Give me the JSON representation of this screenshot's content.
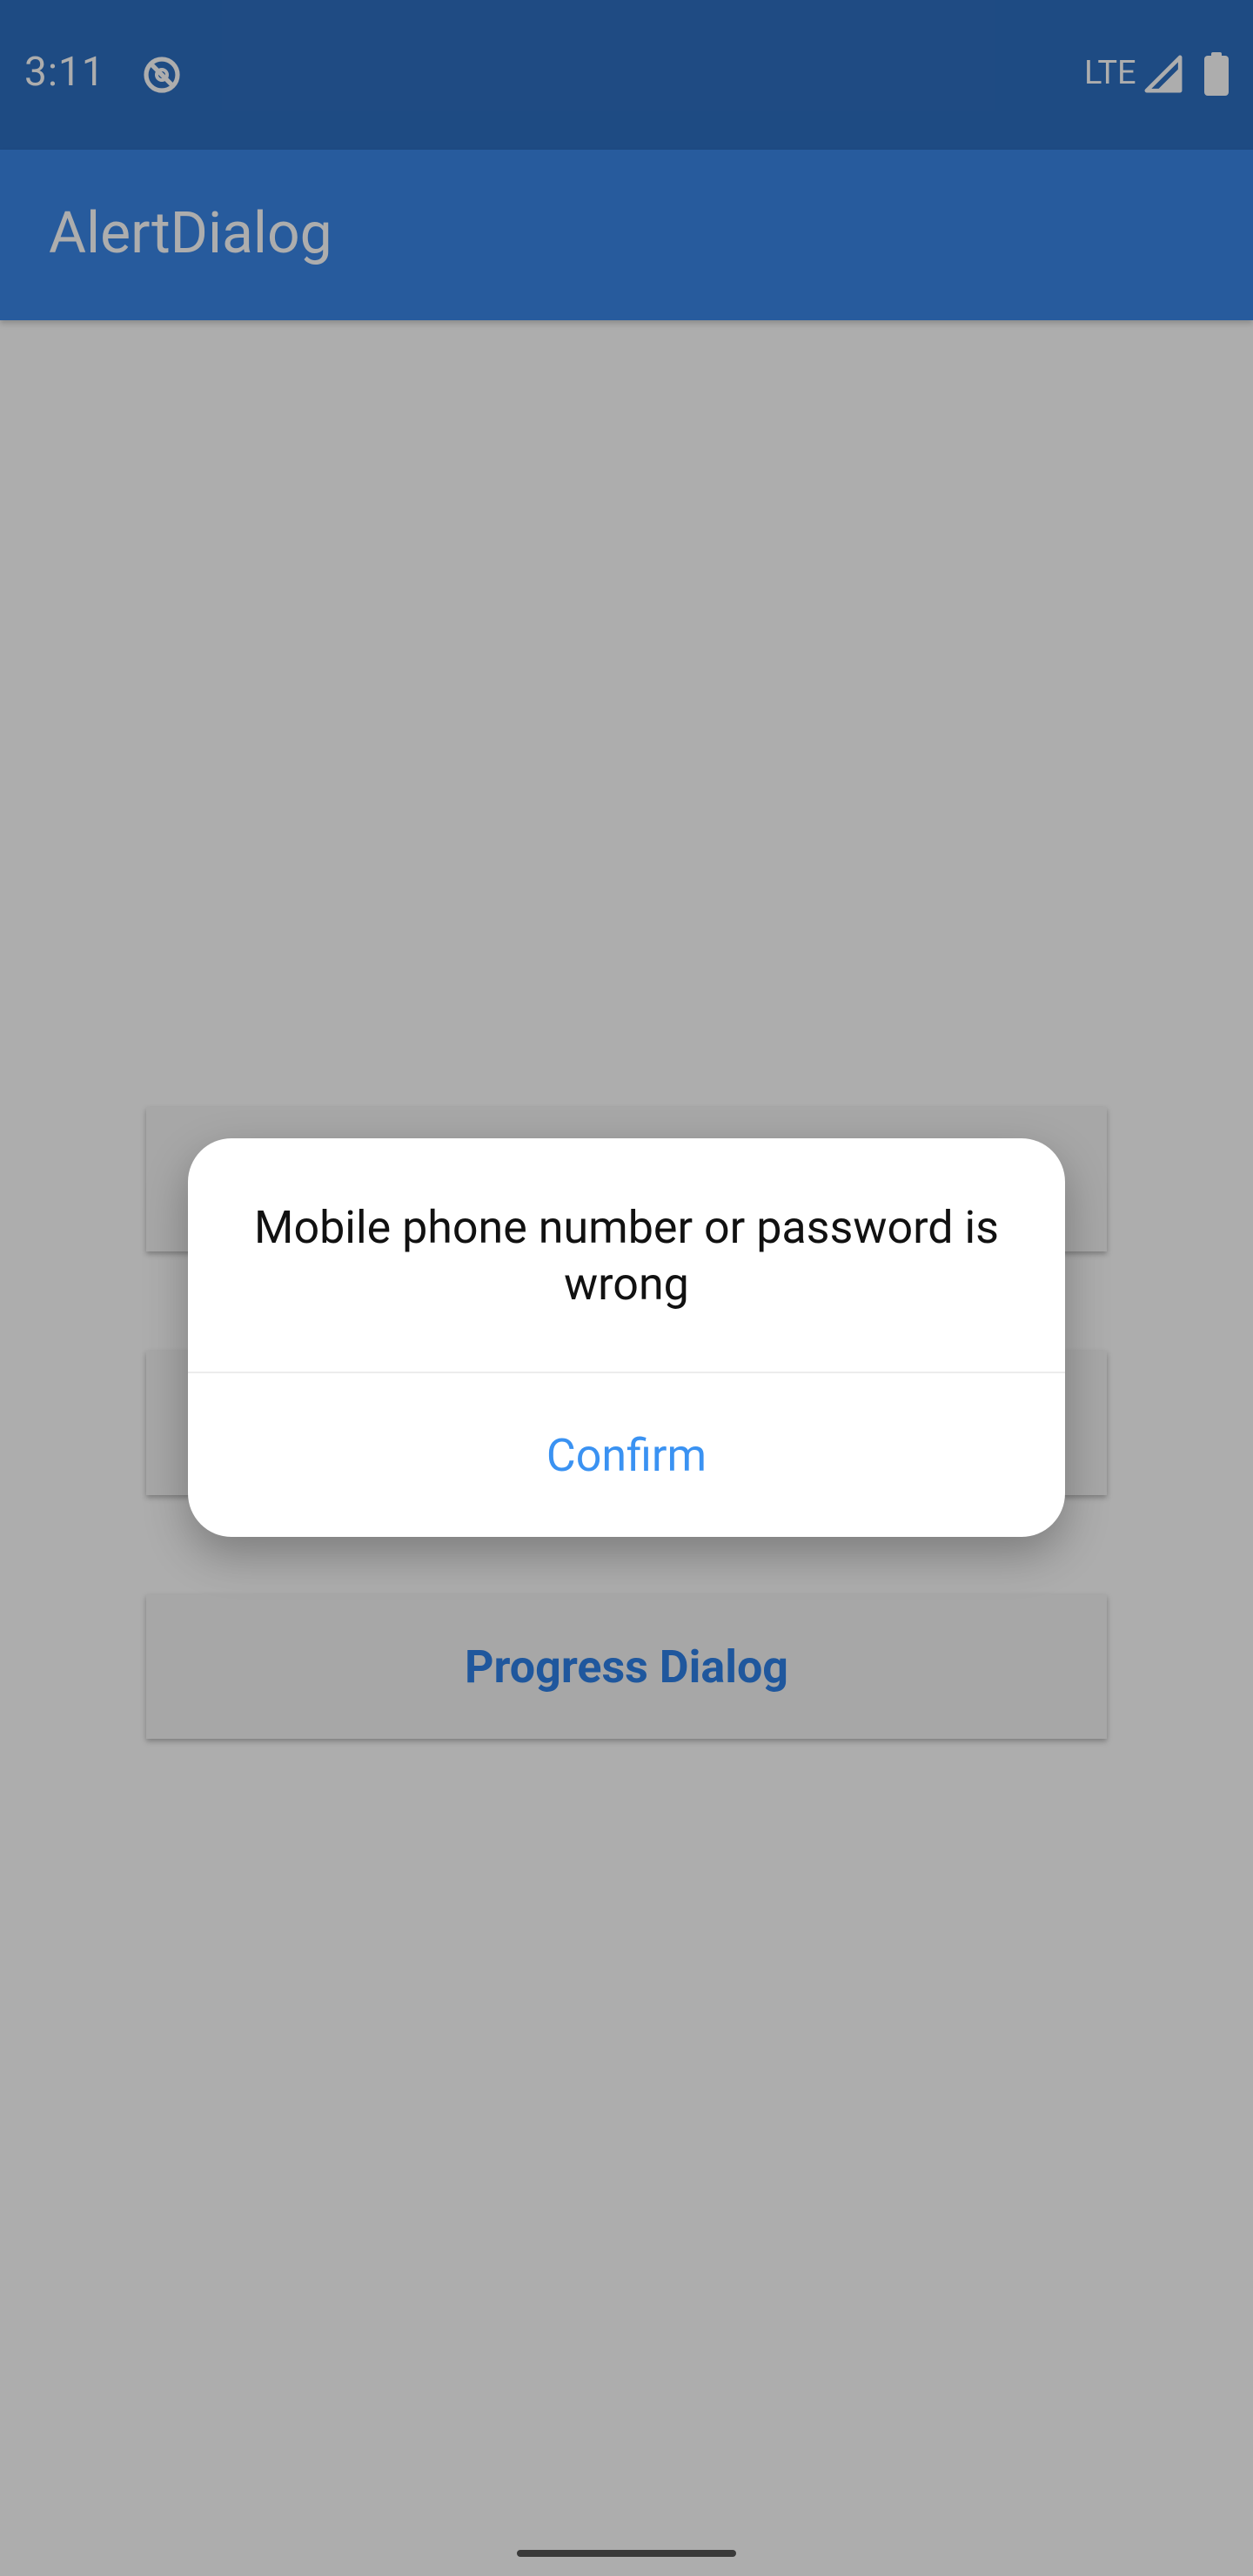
{
  "status_bar": {
    "time": "3:11",
    "network": "LTE",
    "indicator_icon": "do-not-disturb-icon",
    "signal_icon": "signal-icon",
    "battery_icon": "battery-icon"
  },
  "app_bar": {
    "title": "AlertDialog"
  },
  "buttons": [
    {
      "label": ""
    },
    {
      "label": ""
    },
    {
      "label": "Progress Dialog"
    }
  ],
  "dialog": {
    "message": "Mobile phone number or password is wrong",
    "confirm_label": "Confirm"
  },
  "colors": {
    "status_bar": "#2d6fc1",
    "app_bar": "#3a86e8",
    "accent": "#2f80e7",
    "dialog_button": "#3a92f2"
  }
}
